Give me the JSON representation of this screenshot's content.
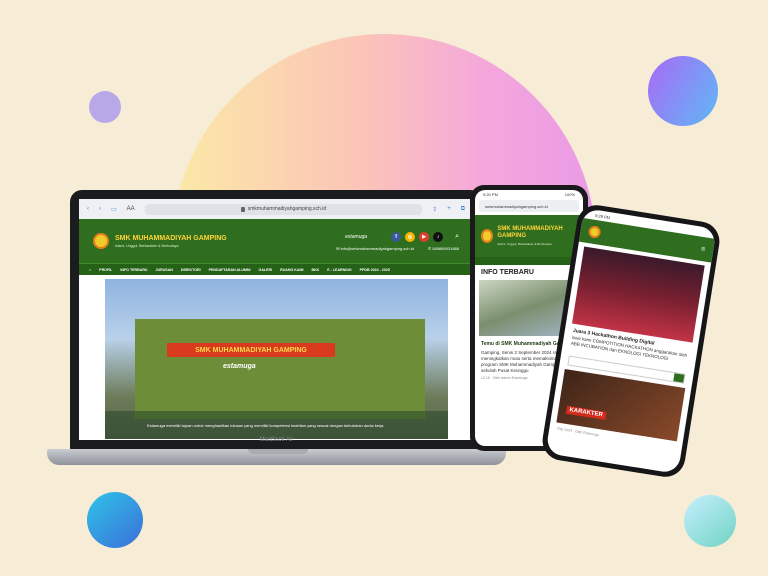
{
  "laptop": {
    "model": "MacBook Air",
    "browser": {
      "text_size": "AA",
      "url": "smkmuhammadiyahgamping.sch.id"
    },
    "site": {
      "title": "SMK MUHAMMADIYAH GAMPING",
      "tagline": "Islami, Unggul, Berkarakter & Berbudaya",
      "brand": "estamuga",
      "email": "info@smkmuhammadiyahgamping.sch.id",
      "phone": "085869531888",
      "nav": [
        "PROFIL",
        "INFO TERBARU",
        "JURUSAN",
        "DIREKTORI",
        "PENDAFTARAN ALUMNI",
        "GALERI",
        "RUANG KAMI",
        "BKK",
        "E - LEARNING",
        "PPDB 2024 - 2025"
      ],
      "hero_sign": "SMK MUHAMMADIYAH GAMPING",
      "hero_brand": "estamuga",
      "hero_caption": "Estamuga memiliki tujuan untuk menghasilkan lulusan yang memiliki kompetensi keahlian yang sesuai dengan kebutuhan dunia kerja."
    }
  },
  "phone_middle": {
    "time": "9:20 PM",
    "battery": "100%",
    "url": "smkmuhammadiyahgamping.sch.id",
    "title": "SMK MUHAMMADIYAH GAMPING",
    "tagline": "Islami, Unggul, Berkarakter & Berbudaya",
    "section": "INFO TERBARU",
    "news_title": "Temu di SMK Muhammadiyah Gamping",
    "news_body": "Gamping, Senin 2 September 2024 rangka meningkatkan mutu serta memaksimalkan program SMK Muhammadiyah Gamping sekolah Pusat Keunggu",
    "news_meta": "12.16 · Oleh admin Estamuga"
  },
  "phone_right": {
    "time": "9:29 PM",
    "news_title": "Juara 3 Hackathon Building Digital",
    "news_body": "iswa kami COMPOTITION HACKATHON anggarakan oleh ABB INCUBATION dan EKNOLOGI TEKNOLOGI",
    "feature_badge": "KARAKTER",
    "feature_meta": "Feb 2024 · Oleh Estamuga"
  },
  "colors": {
    "background": "#f7ecd6",
    "site_green": "#2f6e1f",
    "accent_yellow": "#ffd33a",
    "facebook": "#3b5998",
    "instagram": "#f4b400",
    "youtube": "#e33b2e",
    "tiktok": "#111111"
  },
  "icons": [
    "back-icon",
    "forward-icon",
    "book-icon",
    "share-icon",
    "plus-icon",
    "tabs-icon",
    "facebook-icon",
    "instagram-icon",
    "youtube-icon",
    "tiktok-icon",
    "search-icon",
    "email-icon",
    "phone-icon",
    "menu-icon"
  ]
}
